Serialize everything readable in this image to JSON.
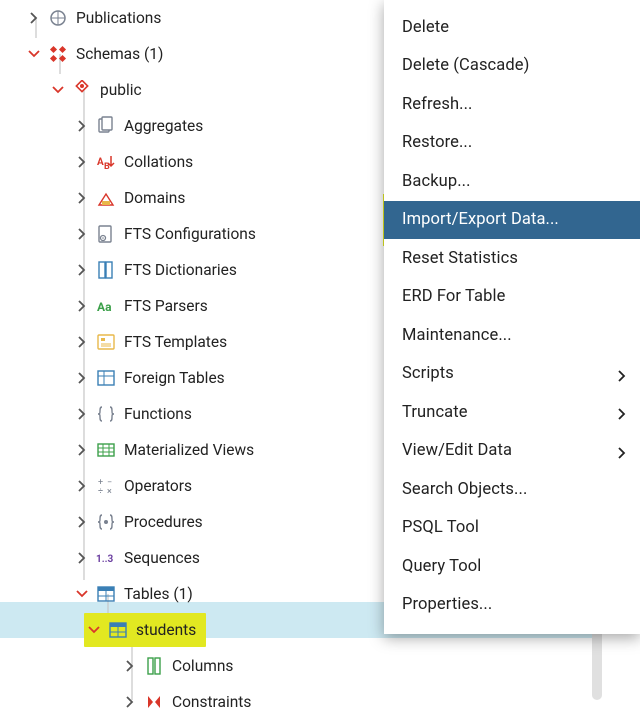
{
  "tree": {
    "publications": "Publications",
    "schemas": "Schemas (1)",
    "public": "public",
    "aggregates": "Aggregates",
    "collations": "Collations",
    "domains": "Domains",
    "fts_configurations": "FTS Configurations",
    "fts_dictionaries": "FTS Dictionaries",
    "fts_parsers": "FTS Parsers",
    "fts_templates": "FTS Templates",
    "foreign_tables": "Foreign Tables",
    "functions": "Functions",
    "materialized_views": "Materialized Views",
    "operators": "Operators",
    "procedures": "Procedures",
    "sequences": "Sequences",
    "tables": "Tables (1)",
    "students": "students",
    "columns": "Columns",
    "constraints": "Constraints"
  },
  "menu": {
    "delete": "Delete",
    "delete_cascade": "Delete (Cascade)",
    "refresh": "Refresh...",
    "restore": "Restore...",
    "backup": "Backup...",
    "import_export": "Import/Export Data...",
    "reset_statistics": "Reset Statistics",
    "erd": "ERD For Table",
    "maintenance": "Maintenance...",
    "scripts": "Scripts",
    "truncate": "Truncate",
    "view_edit_data": "View/Edit Data",
    "search_objects": "Search Objects...",
    "psql_tool": "PSQL Tool",
    "query_tool": "Query Tool",
    "properties": "Properties..."
  }
}
